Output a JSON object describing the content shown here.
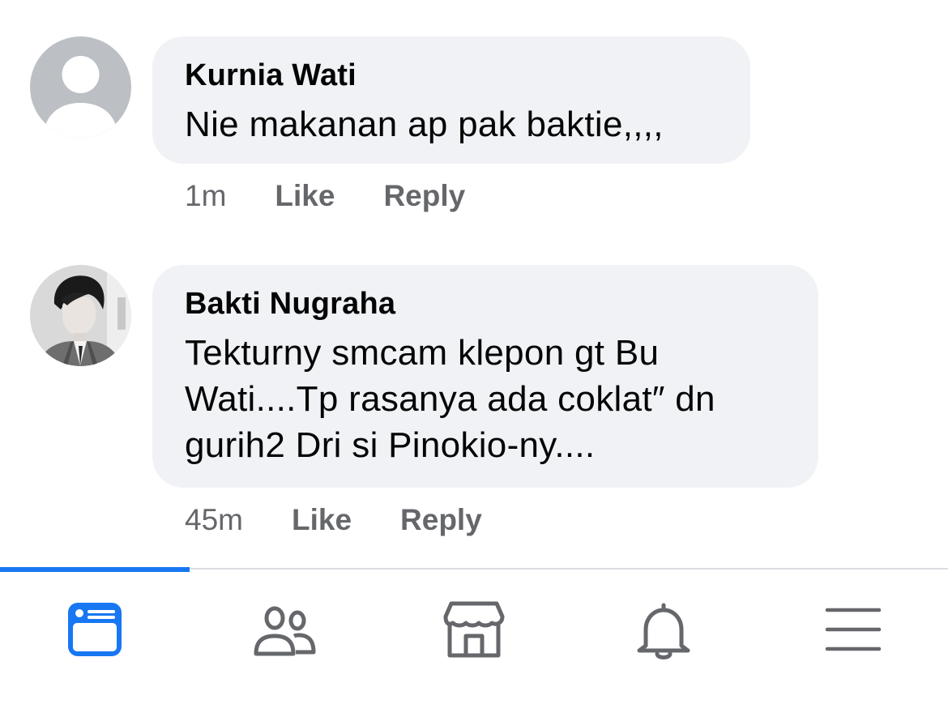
{
  "comments": [
    {
      "author": "Kurnia Wati",
      "text": "Nie makanan ap pak baktie,,,,",
      "time": "1m",
      "like_label": "Like",
      "reply_label": "Reply",
      "avatar": "default-avatar"
    },
    {
      "author": "Bakti Nugraha",
      "text": "Tekturny smcam klepon gt Bu Wati....Tp rasanya ada coklat″ dn gurih2 Dri si Pinokio-ny....",
      "time": "45m",
      "like_label": "Like",
      "reply_label": "Reply",
      "avatar": "profile-photo"
    }
  ],
  "tabbar": {
    "active_tab": "feed",
    "accent_color": "#1877f2",
    "icon_color": "#65676b",
    "tabs": [
      {
        "id": "feed",
        "icon": "news-feed-icon"
      },
      {
        "id": "friends",
        "icon": "friends-icon"
      },
      {
        "id": "marketplace",
        "icon": "marketplace-icon"
      },
      {
        "id": "notifications",
        "icon": "bell-icon"
      },
      {
        "id": "menu",
        "icon": "menu-icon"
      }
    ]
  }
}
